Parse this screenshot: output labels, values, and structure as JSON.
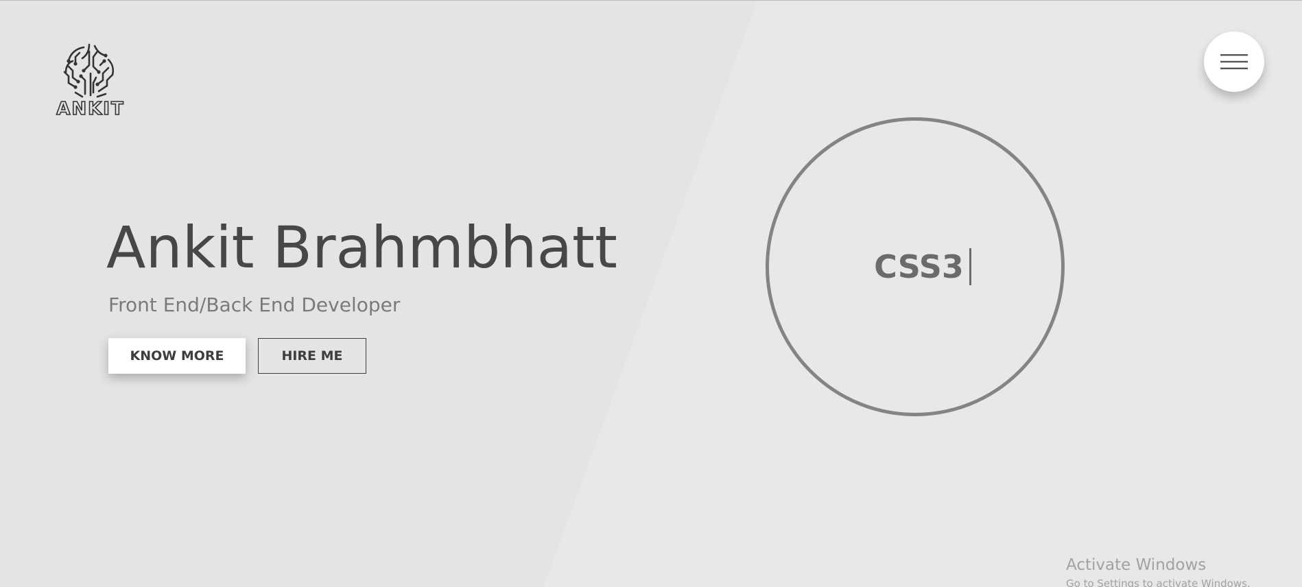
{
  "logo": {
    "text": "ANKIT"
  },
  "menu": {
    "icon": "hamburger-menu-icon"
  },
  "hero": {
    "name": "Ankit Brahmbhatt",
    "role": "Front End/Back End Developer",
    "buttons": {
      "know_more": "KNOW MORE",
      "hire_me": "HIRE ME"
    }
  },
  "skill_circle": {
    "typed_text": "CSS3"
  },
  "watermark": {
    "title": "Activate Windows",
    "subtitle": "Go to Settings to activate Windows."
  },
  "colors": {
    "background": "#e8e8e8",
    "text_dark": "#474747",
    "text_muted": "#7a7a7a",
    "circle_border": "#848484"
  }
}
